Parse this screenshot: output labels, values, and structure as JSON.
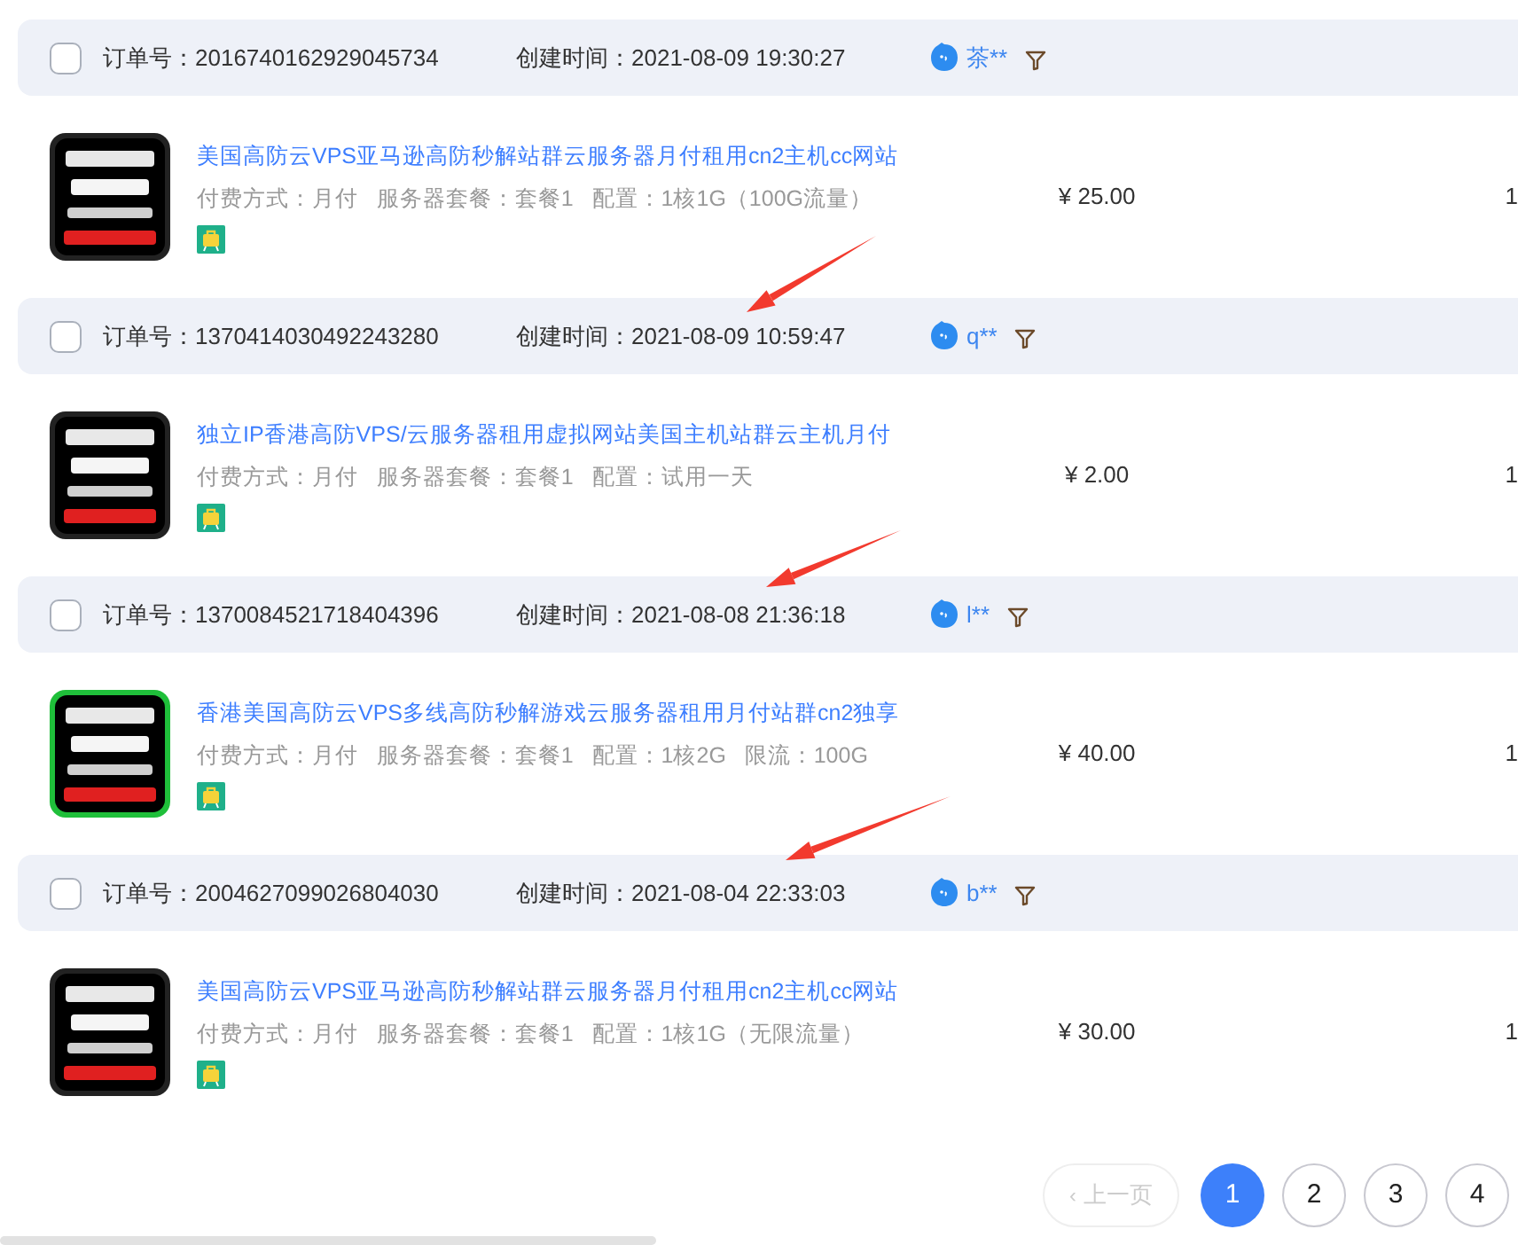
{
  "orders": [
    {
      "order_label": "订单号：",
      "order_no": "2016740162929045734",
      "time_label": "创建时间：",
      "created": "2021-08-09 19:30:27",
      "buyer": "茶**",
      "checked": false,
      "title": "美国高防云VPS亚马逊高防秒解站群云服务器月付租用cn2主机cc网站",
      "specs": "付费方式：月付   服务器套餐：套餐1   配置：1核1G（100G流量）",
      "price": "¥ 25.00",
      "qty": "1"
    },
    {
      "order_label": "订单号：",
      "order_no": "1370414030492243280",
      "time_label": "创建时间：",
      "created": "2021-08-09 10:59:47",
      "buyer": "q**",
      "checked": false,
      "title": "独立IP香港高防VPS/云服务器租用虚拟网站美国主机站群云主机月付",
      "specs": "付费方式：月付   服务器套餐：套餐1   配置：试用一天",
      "price": "¥ 2.00",
      "qty": "1"
    },
    {
      "order_label": "订单号：",
      "order_no": "1370084521718404396",
      "time_label": "创建时间：",
      "created": "2021-08-08 21:36:18",
      "buyer": "l**",
      "checked": false,
      "title": "香港美国高防云VPS多线高防秒解游戏云服务器租用月付站群cn2独享",
      "specs": "付费方式：月付   服务器套餐：套餐1   配置：1核2G   限流：100G",
      "price": "¥ 40.00",
      "qty": "1"
    },
    {
      "order_label": "订单号：",
      "order_no": "2004627099026804030",
      "time_label": "创建时间：",
      "created": "2021-08-04 22:33:03",
      "buyer": "b**",
      "checked": false,
      "title": "美国高防云VPS亚马逊高防秒解站群云服务器月付租用cn2主机cc网站",
      "specs": "付费方式：月付   服务器套餐：套餐1   配置：1核1G（无限流量）",
      "price": "¥ 30.00",
      "qty": "1"
    }
  ],
  "pagination": {
    "prev": {
      "icon": "‹",
      "label": "上一页",
      "disabled": true
    },
    "pages": [
      {
        "label": "1",
        "selected": true
      },
      {
        "label": "2",
        "selected": false
      },
      {
        "label": "3",
        "selected": false
      },
      {
        "label": "4",
        "selected": false
      }
    ]
  }
}
